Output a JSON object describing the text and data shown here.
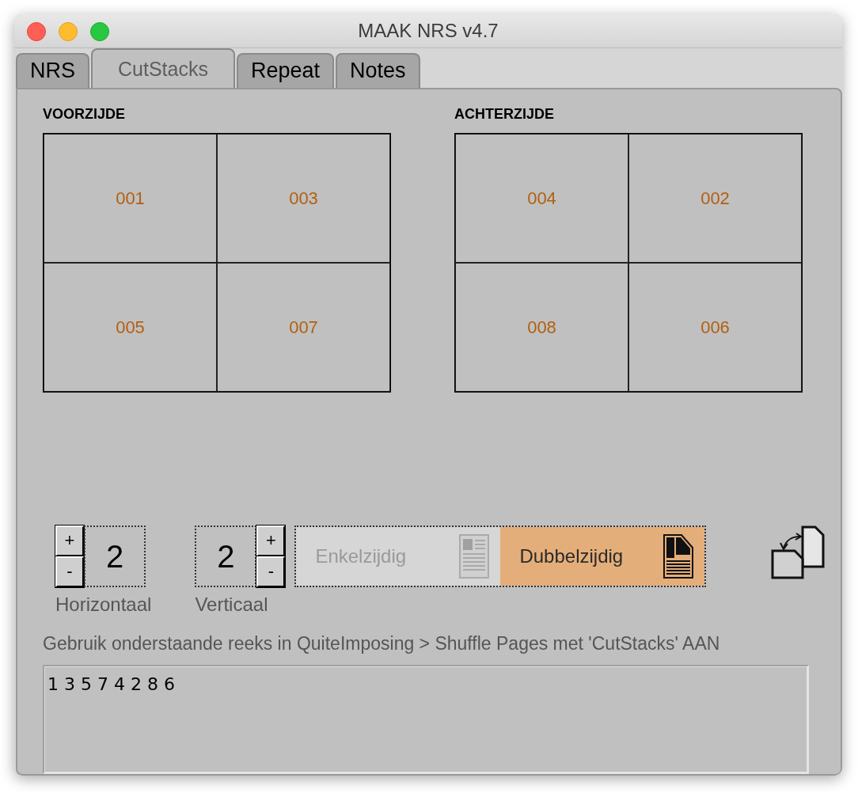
{
  "window": {
    "title": "MAAK NRS v4.7"
  },
  "tabs": [
    {
      "label": "NRS",
      "selected": false
    },
    {
      "label": "CutStacks",
      "selected": true
    },
    {
      "label": "Repeat",
      "selected": false
    },
    {
      "label": "Notes",
      "selected": false
    }
  ],
  "sheets": [
    {
      "label": "VOORZIJDE",
      "cells": [
        "001",
        "003",
        "005",
        "007"
      ]
    },
    {
      "label": "ACHTERZIJDE",
      "cells": [
        "004",
        "002",
        "008",
        "006"
      ]
    }
  ],
  "horizontal": {
    "plus": "+",
    "minus": "-",
    "value": "2",
    "label": "Horizontaal"
  },
  "vertical": {
    "plus": "+",
    "minus": "-",
    "value": "2",
    "label": "Verticaal"
  },
  "sides": [
    {
      "label": "Enkelzijdig",
      "selected": false
    },
    {
      "label": "Dubbelzijdig",
      "selected": true
    }
  ],
  "instruction": "Gebruik onderstaande reeks in QuiteImposing > Shuffle Pages met 'CutStacks' AAN",
  "sequence": "1 3 5 7 4 2 8 6"
}
